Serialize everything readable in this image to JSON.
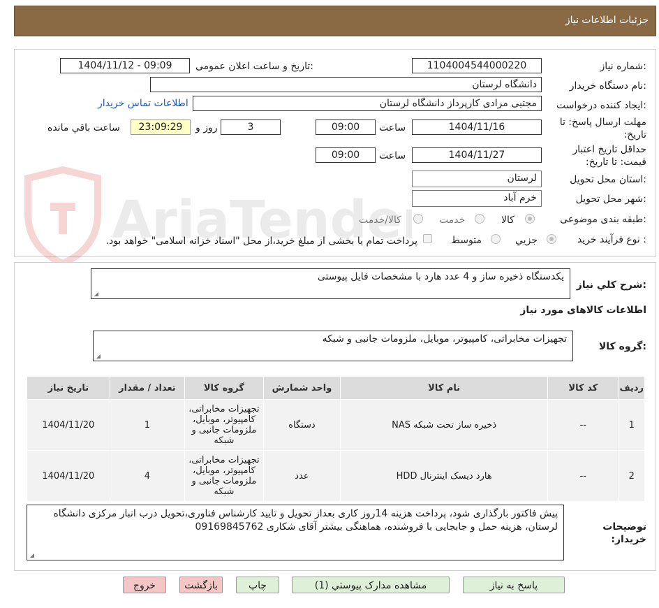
{
  "header": {
    "title": "جزئیات اطلاعات نیاز"
  },
  "fields": {
    "need_number_label": "شماره نیاز:",
    "need_number": "1104004544000220",
    "announce_label": "تاریخ و ساعت اعلان عمومی:",
    "announce_value": "1404/11/12 - 09:09",
    "buyer_org_label": "نام دستگاه خریدار:",
    "buyer_org": "دانشگاه لرستان",
    "requester_label": "ایجاد کننده درخواست:",
    "requester": "مجتبی مرادی کارپرداز دانشگاه لرستان",
    "buyer_contact_link": "اطلاعات تماس خریدار",
    "deadline_label": "مهلت ارسال پاسخ: تا تاریخ:",
    "deadline_date": "1404/11/16",
    "time_label": "ساعت",
    "deadline_time": "09:00",
    "days": "3",
    "days_label": "روز و",
    "remaining_time": "23:09:29",
    "remaining_label": "ساعت باقي مانده",
    "price_validity_label": "حداقل تاریخ اعتبار قیمت: تا تاریخ:",
    "price_validity_date": "1404/11/27",
    "price_validity_time": "09:00",
    "province_label": "استان محل تحویل:",
    "province": "لرستان",
    "city_label": "شهر محل تحویل:",
    "city": "خرم آباد",
    "category_label": "طبقه بندی موضوعی:",
    "category_options": [
      "کالا",
      "خدمت",
      "کالا/خدمت"
    ],
    "process_label": "نوع فرآیند خرید :",
    "process_options": [
      "جزیي",
      "متوسط"
    ],
    "process_note": "پرداخت تمام یا بخشی از مبلغ خرید،از محل \"اسناد خزانه اسلامی\" خواهد بود."
  },
  "summary": {
    "label": "شرح کلي نیاز:",
    "text": "یکدستگاه ذخیره ساز و 4 عدد هارد با مشخصات فایل پیوستی",
    "goods_info_title": "اطلاعات کالاهای مورد نیاز",
    "group_label": "گروه کالا:",
    "group_text": "تجهیزات مخابراتی، کامپیوتر، موبایل، ملزومات جانبی و شبکه"
  },
  "table": {
    "headers": [
      "ردیف",
      "کد کالا",
      "نام کالا",
      "واحد شمارش",
      "گروه کالا",
      "تعداد / مقدار",
      "تاریخ نیاز"
    ],
    "rows": [
      [
        "1",
        "--",
        "ذخیره ساز تحت شبکه NAS",
        "دستگاه",
        "تجهیزات مخابراتی، کامپیوتر، موبایل، ملزومات جانبی و شبکه",
        "1",
        "1404/11/20"
      ],
      [
        "2",
        "--",
        "هارد دیسک اینترنال HDD",
        "عدد",
        "تجهیزات مخابراتی، کامپیوتر، موبایل، ملزومات جانبی و شبکه",
        "4",
        "1404/11/20"
      ]
    ]
  },
  "notes": {
    "label": "توضیحات خریدار:",
    "text": "پیش فاکتور بارگذاری شود، پرداخت هزینه 14روز کاری بعداز تحویل و تایید کارشناس فناوری،تحویل درب انبار مرکزی دانشگاه لرستان، هزینه  حمل و جابجایی با فروشنده، هماهنگی بیشتر آقای شکاری 09169845762"
  },
  "buttons": {
    "reply": "پاسخ به نیاز",
    "attachments": "مشاهده مدارک پیوستي (1)",
    "print": "چاپ",
    "back": "بازگشت",
    "exit": "خروج"
  },
  "watermark": {
    "text": "AriaTender.neT"
  },
  "colors": {
    "header_bg": "#8a6a44",
    "remaining_bg": "#ffffc6",
    "button_green": "#dff0d8",
    "button_pink": "#f4c6c6",
    "link": "#1a56c9"
  }
}
